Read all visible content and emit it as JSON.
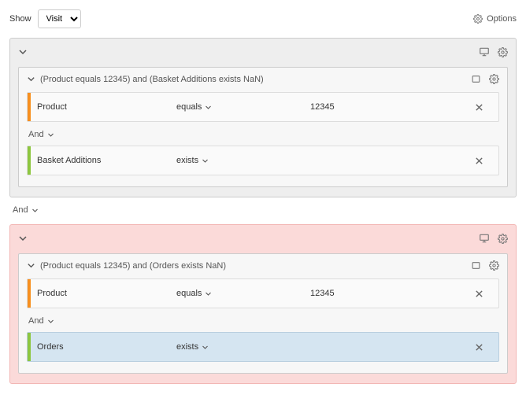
{
  "toolbar": {
    "show_label": "Show",
    "show_value": "Visit",
    "options_label": "Options"
  },
  "outer_connector": "And",
  "groups": [
    {
      "excluded": false,
      "subgroup": {
        "summary": "(Product equals 12345) and (Basket Additions exists NaN)",
        "rules": [
          {
            "bar": "orange",
            "dimension": "Product",
            "operator": "equals",
            "value": "12345",
            "selected": false
          },
          {
            "bar": "green",
            "dimension": "Basket Additions",
            "operator": "exists",
            "value": "",
            "selected": false
          }
        ],
        "connector": "And"
      }
    },
    {
      "excluded": true,
      "subgroup": {
        "summary": "(Product equals 12345) and (Orders exists NaN)",
        "rules": [
          {
            "bar": "orange",
            "dimension": "Product",
            "operator": "equals",
            "value": "12345",
            "selected": false
          },
          {
            "bar": "green",
            "dimension": "Orders",
            "operator": "exists",
            "value": "",
            "selected": true
          }
        ],
        "connector": "And"
      }
    }
  ]
}
